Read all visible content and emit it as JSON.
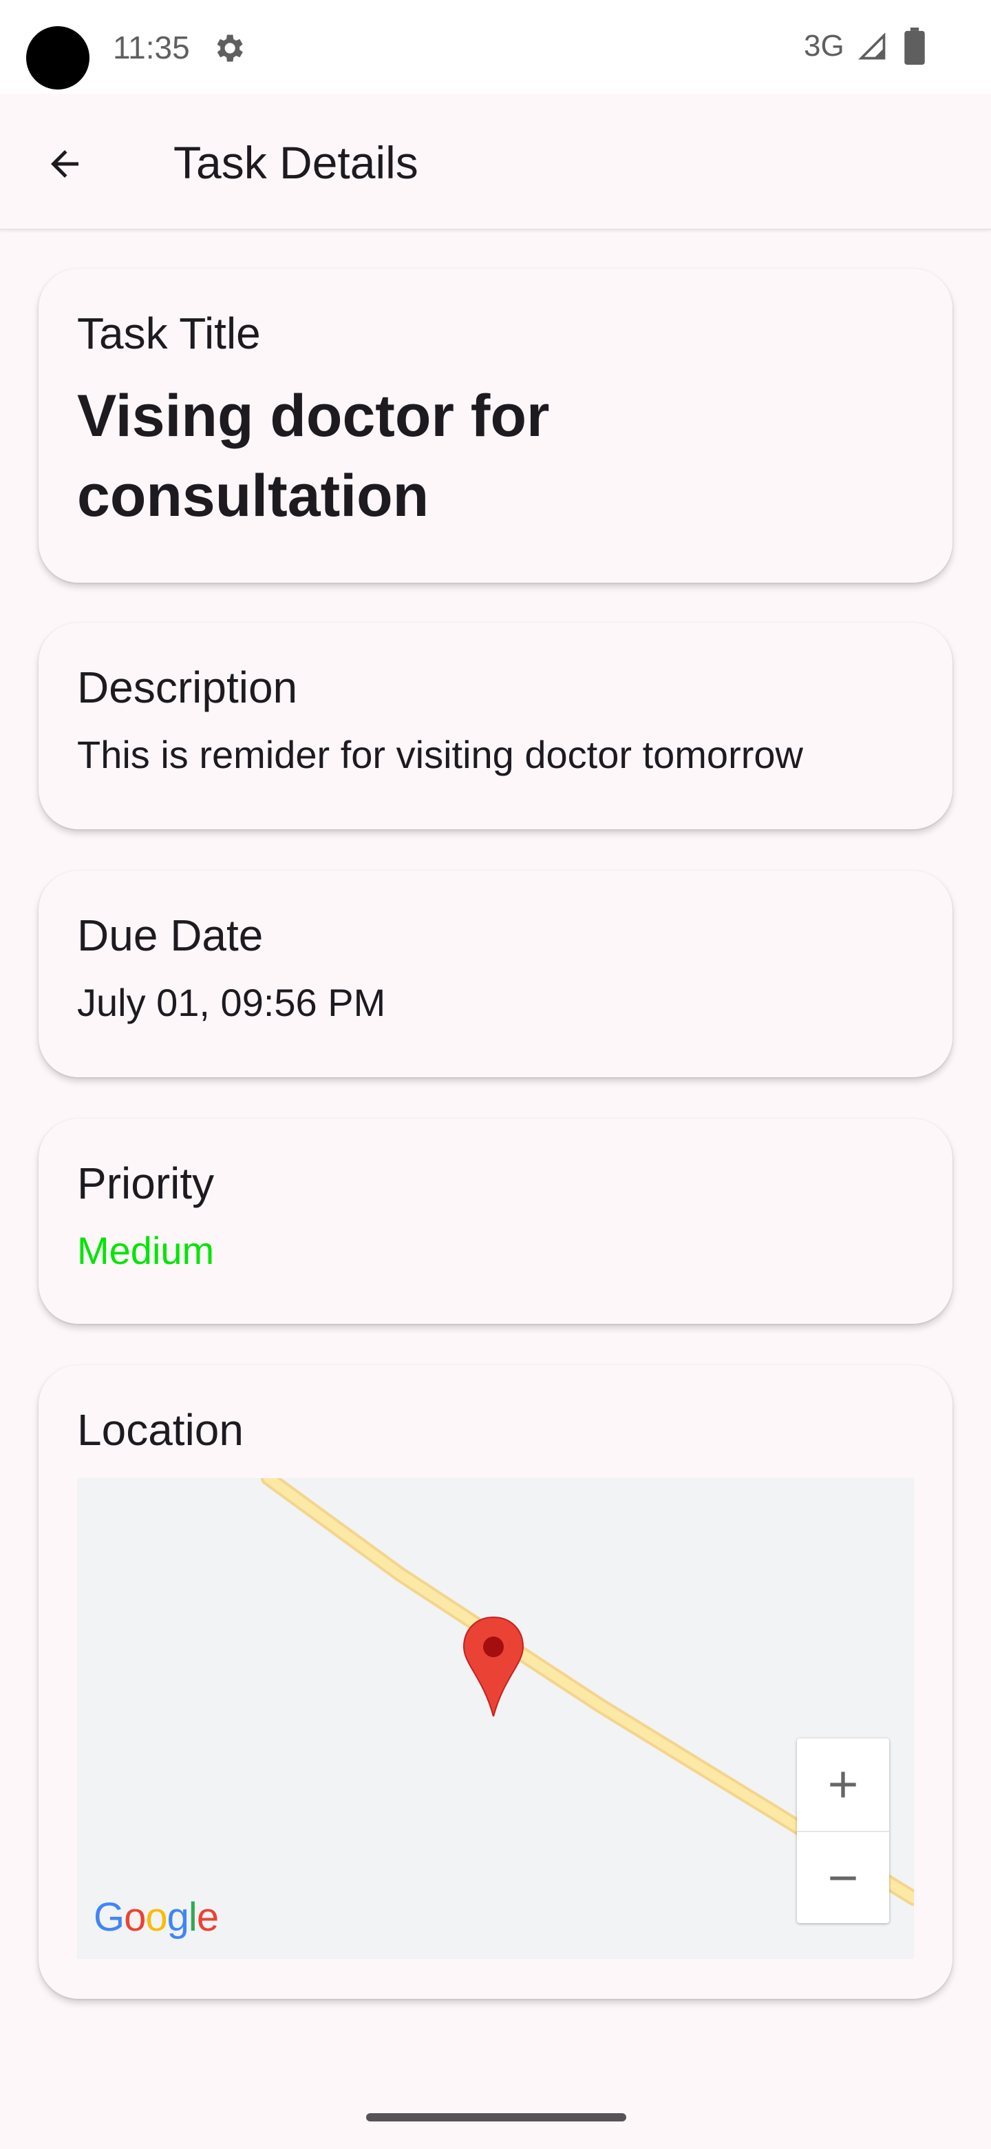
{
  "status_bar": {
    "time": "11:35",
    "network": "3G",
    "icons": [
      "settings-gear-icon",
      "cell-signal-icon",
      "battery-icon"
    ]
  },
  "app_bar": {
    "title": "Task Details",
    "back_icon": "arrow-back-icon"
  },
  "task": {
    "title_label": "Task Title",
    "title_value": "Vising doctor for consultation",
    "description_label": "Description",
    "description_value": "This is remider for visiting doctor tomorrow",
    "due_label": "Due Date",
    "due_value": "July 01, 09:56 PM",
    "priority_label": "Priority",
    "priority_value": "Medium",
    "location_label": "Location"
  },
  "map": {
    "attribution": "Google",
    "zoom_in_label": "+",
    "zoom_out_label": "−",
    "marker_icon": "map-marker-icon"
  },
  "colors": {
    "priority_medium": "#00e600",
    "background": "#fdf7fa",
    "marker": "#ea4335",
    "road": "#fde293"
  }
}
